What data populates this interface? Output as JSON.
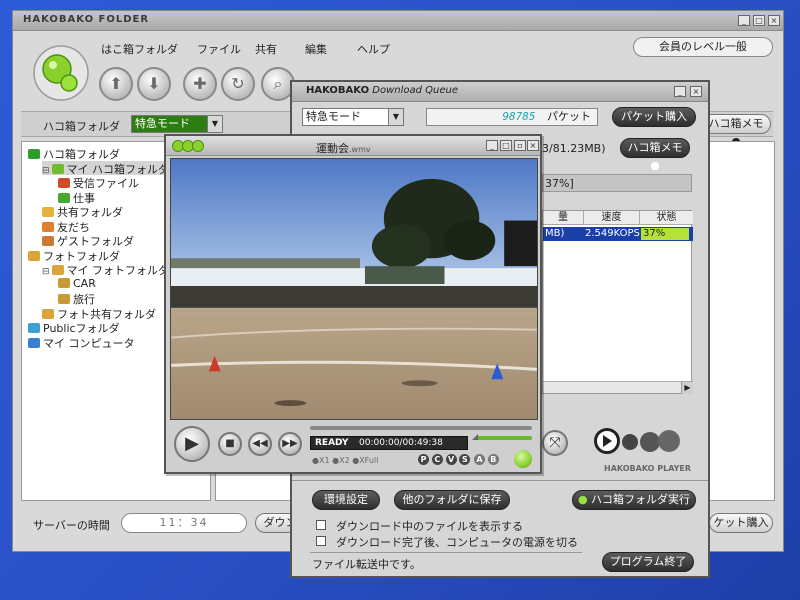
{
  "main_window": {
    "title": "HAKOBAKO FOLDER",
    "menu": [
      "はこ箱フォルダ",
      "ファイル",
      "共有",
      "編集",
      "ヘルプ"
    ],
    "member_badge": "会員のレベル一般",
    "folder_bar": {
      "label": "ハコ箱フォルダ",
      "mode": "特急モード",
      "memo_button": "ハコ箱メモ"
    },
    "tree": [
      {
        "label": "ハコ箱フォルダ",
        "level": 0,
        "icon_color": "#2e9d2e",
        "expander": "",
        "selected": false
      },
      {
        "label": "マイ ハコ箱フォルダ",
        "level": 1,
        "icon_color": "#6fbd2f",
        "expander": "⊟",
        "selected": true
      },
      {
        "label": "受信ファイル",
        "level": 2,
        "icon_color": "#d34a2a",
        "expander": "",
        "selected": false
      },
      {
        "label": "仕事",
        "level": 2,
        "icon_color": "#4aa82e",
        "expander": "",
        "selected": false
      },
      {
        "label": "共有フォルダ",
        "level": 1,
        "icon_color": "#e8b13c",
        "expander": "",
        "selected": false
      },
      {
        "label": "友だち",
        "level": 1,
        "icon_color": "#e07f2c",
        "expander": "",
        "selected": false
      },
      {
        "label": "ゲストフォルダ",
        "level": 1,
        "icon_color": "#cc7a33",
        "expander": "",
        "selected": false
      },
      {
        "label": "フォトフォルダ",
        "level": 0,
        "icon_color": "#d9a43a",
        "expander": "",
        "selected": false
      },
      {
        "label": "マイ フォトフォルダ",
        "level": 1,
        "icon_color": "#d9a43a",
        "expander": "⊟",
        "selected": false
      },
      {
        "label": "CAR",
        "level": 2,
        "icon_color": "#c79a36",
        "expander": "",
        "selected": false
      },
      {
        "label": "旅行",
        "level": 2,
        "icon_color": "#c79a36",
        "expander": "",
        "selected": false
      },
      {
        "label": "フォト共有フォルダ",
        "level": 1,
        "icon_color": "#d9a43a",
        "expander": "",
        "selected": false
      },
      {
        "label": "Publicフォルダ",
        "level": 0,
        "icon_color": "#3ea0d8",
        "expander": "",
        "selected": false
      },
      {
        "label": "マイ コンピュータ",
        "level": 0,
        "icon_color": "#3a7fd0",
        "expander": "",
        "selected": false
      }
    ],
    "server_time_label": "サーバーの時間",
    "server_time": "11：34",
    "download_button_partial": "ダウン",
    "packet_buy_partial": "ケット購入"
  },
  "download_queue": {
    "title_bold": "HAKOBAKO",
    "title_rest": " Download Queue",
    "mode": "特急モード",
    "packets_value": "98785",
    "packets_unit": "パケット",
    "buy_button": "パケット購入",
    "size_text": "3/81.23MB)",
    "memo_button": "ハコ箱メモ",
    "progress_text": "37%]",
    "columns": [
      "量",
      "速度",
      "状態"
    ],
    "row": {
      "size": "MB)",
      "speed": "2.549KOPS",
      "status": "37%"
    },
    "settings_button": "環境設定",
    "save_other_button": "他のフォルダに保存",
    "run_button": "ハコ箱フォルダ実行",
    "check1": "ダウンロード中のファイルを表示する",
    "check2": "ダウンロード完了後、コンピュータの電源を切る",
    "status_text": "ファイル転送中です。",
    "exit_button": "プログラム終了",
    "player_brand": "HAKOBAKO PLAYER"
  },
  "player": {
    "title": "運動会",
    "title_ext": ".wmv",
    "status": "READY",
    "time": "00:00:00/00:49:38",
    "zoom_opts": [
      "X1",
      "X2",
      "XFull"
    ],
    "letters": [
      "P",
      "C",
      "V",
      "S"
    ],
    "ab": [
      "A",
      "B"
    ]
  }
}
